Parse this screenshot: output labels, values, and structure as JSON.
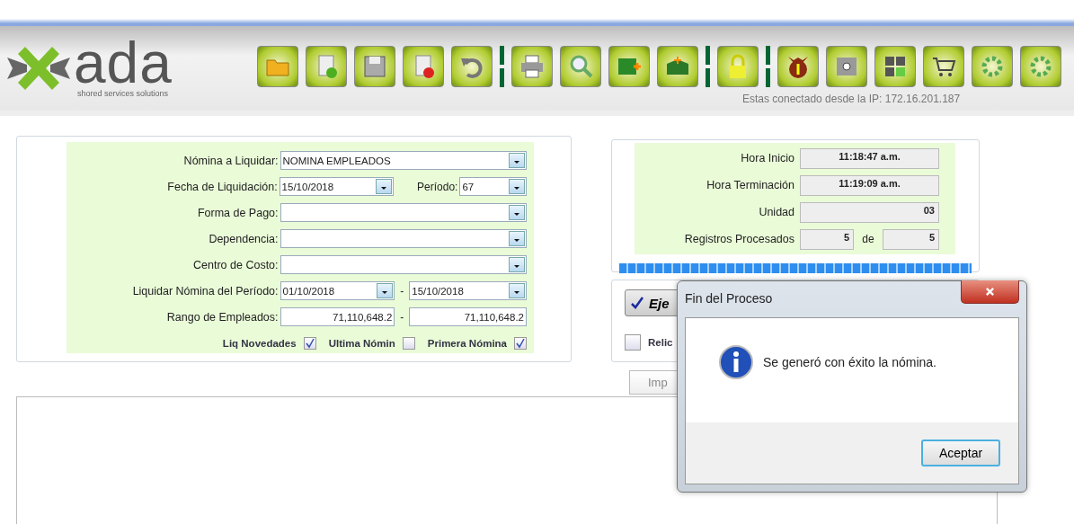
{
  "logo": {
    "name": "ada",
    "tagline": "shored services solutions"
  },
  "connection_text": "Estas conectado desde la IP: 172.16.201.187",
  "form": {
    "fields": [
      {
        "kind": "combo",
        "label": "Nómina a Liquidar:",
        "value": "NOMINA EMPLEADOS"
      },
      {
        "kind": "date_combo",
        "label": "Fecha de Liquidación:",
        "value": "15/10/2018",
        "extra_label": "Período:",
        "extra_value": "67"
      },
      {
        "kind": "combo",
        "label": "Forma de Pago:"
      },
      {
        "kind": "combo",
        "label": "Dependencia:"
      },
      {
        "kind": "combo",
        "label": "Centro de Costo:"
      },
      {
        "kind": "date_range",
        "label": "Liquidar Nómina del Período:",
        "from": "01/10/2018",
        "separator": "-",
        "to": "15/10/2018"
      },
      {
        "kind": "text_range",
        "label": "Rango de Empleados:",
        "from": "71,110,648.2",
        "separator": "-",
        "to": "71,110,648.2"
      }
    ],
    "checkboxes": [
      {
        "label": "Liq Novedades",
        "checked": true
      },
      {
        "label": "Ultima Nómin",
        "checked": false
      },
      {
        "label": "Primera Nómina",
        "checked": true
      }
    ]
  },
  "status": {
    "rows": [
      {
        "kind": "time",
        "label": "Hora Inicio",
        "value": "11:18:47 a.m."
      },
      {
        "kind": "time",
        "label": "Hora Terminación",
        "value": "11:19:09 a.m."
      },
      {
        "kind": "number",
        "label": "Unidad",
        "value": "03"
      }
    ],
    "records": {
      "label": "Registros Procesados",
      "processed": "5",
      "of_label": "de",
      "total": "5"
    },
    "progress": {
      "level": 1
    }
  },
  "actions": {
    "execute_button": "Eje",
    "checkbox": {
      "label": "Relic",
      "checked": false
    },
    "print_button": "Imp"
  },
  "dialog": {
    "title": "Fin del Proceso",
    "message": "Se generó con éxito la nómina.",
    "button": "Aceptar"
  }
}
